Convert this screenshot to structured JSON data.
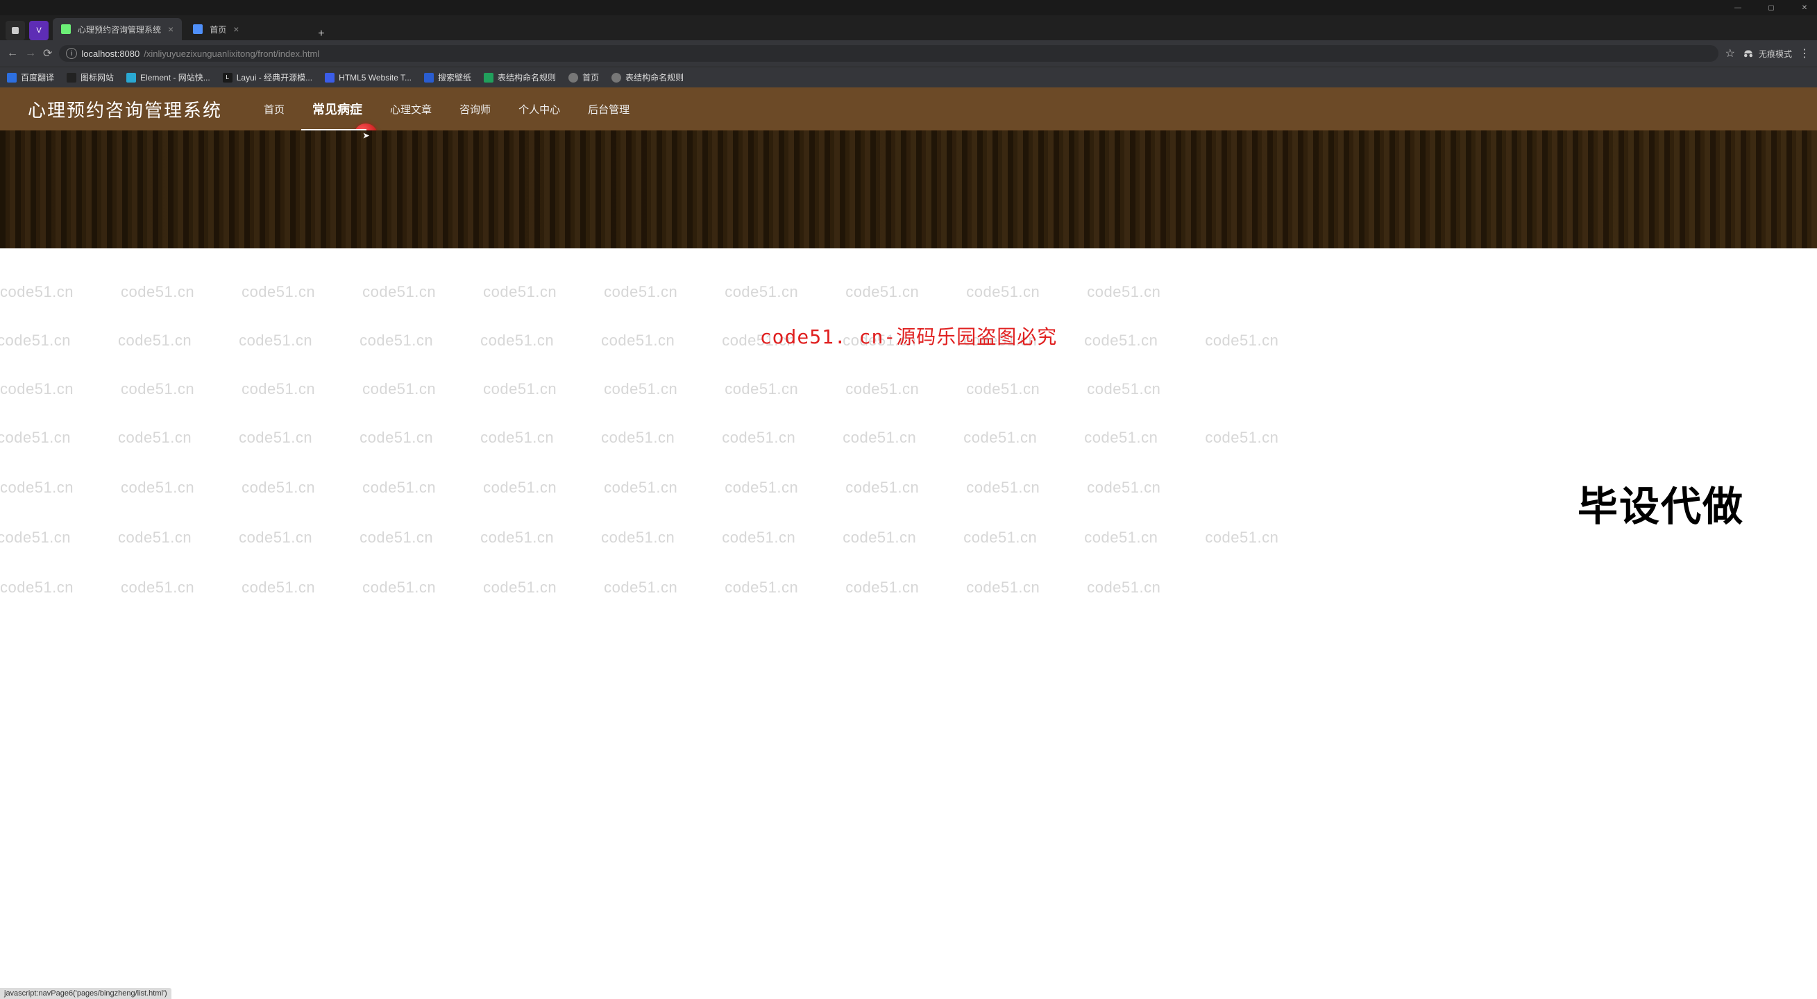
{
  "browser": {
    "tabs": [
      {
        "label": "心理预约咨询管理系统"
      },
      {
        "label": "首页"
      }
    ],
    "url_host": "localhost:8080",
    "url_path": "/xinliyuyuezixunguanlixitong/front/index.html",
    "incognito_label": "无痕模式",
    "status_text": "javascript:navPage6('pages/bingzheng/list.html')"
  },
  "bookmarks": [
    {
      "label": "百度翻译",
      "color": "#2d6fe0"
    },
    {
      "label": "图标网站",
      "color": "#222"
    },
    {
      "label": "Element - 网站快...",
      "color": "#2aa8d2"
    },
    {
      "label": "Layui - 经典开源模...",
      "color": "#1a1a1a"
    },
    {
      "label": "HTML5 Website T...",
      "color": "#3b5de8"
    },
    {
      "label": "搜索壁纸",
      "color": "#2a5dd0"
    },
    {
      "label": "表结构命名规则",
      "color": "#21a05c"
    },
    {
      "label": "首页",
      "color": "#777"
    },
    {
      "label": "表结构命名规则",
      "color": "#777"
    }
  ],
  "site": {
    "title": "心理预约咨询管理系统",
    "nav": [
      {
        "label": "首页"
      },
      {
        "label": "常见病症"
      },
      {
        "label": "心理文章"
      },
      {
        "label": "咨询师"
      },
      {
        "label": "个人中心"
      },
      {
        "label": "后台管理"
      }
    ],
    "center_red": "code51. cn-源码乐园盗图必究",
    "watermark": "code51.cn",
    "big_black": "毕设代做"
  }
}
